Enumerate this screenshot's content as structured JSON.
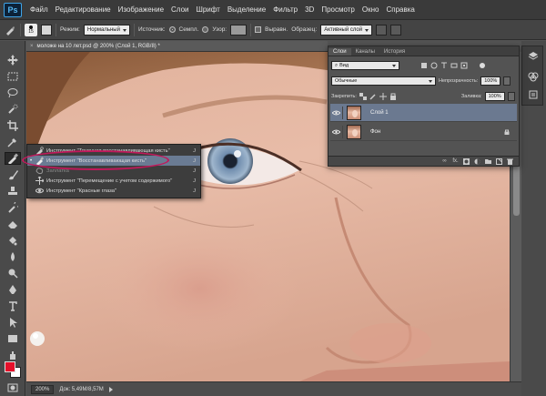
{
  "app": {
    "logo": "Ps"
  },
  "menu": {
    "items": [
      "Файл",
      "Редактирование",
      "Изображение",
      "Слои",
      "Шрифт",
      "Выделение",
      "Фильтр",
      "3D",
      "Просмотр",
      "Окно",
      "Справка"
    ]
  },
  "options": {
    "brush_size": "15",
    "mode_label": "Режим:",
    "mode_value": "Нормальный",
    "source_label": "Источник:",
    "source_sampled": "Семпл.",
    "source_pattern": "Узор:",
    "aligned_label": "Выравн.",
    "sample_label": "Образец:",
    "sample_value": "Активный слой"
  },
  "document": {
    "tab_title": "моложе на 10 лет.psd @ 200% (Слой 1, RGB/8) *",
    "status_zoom": "200%",
    "status_doc": "Док: 5,49M/8,57M"
  },
  "tool_flyout": {
    "items": [
      {
        "label": "Инструмент \"Точечная восстанавливающая кисть\"",
        "key": "J",
        "selected": false,
        "checked": false,
        "dim": false,
        "icon": "spot-healing-brush-icon"
      },
      {
        "label": "Инструмент \"Восстанавливающая кисть\"",
        "key": "J",
        "selected": true,
        "checked": true,
        "dim": false,
        "icon": "healing-brush-icon"
      },
      {
        "label": "Заплатка",
        "key": "J",
        "selected": false,
        "checked": false,
        "dim": true,
        "icon": "patch-icon"
      },
      {
        "label": "Инструмент \"Перемещение с учетом содержимого\"",
        "key": "J",
        "selected": false,
        "checked": false,
        "dim": false,
        "icon": "content-aware-move-icon"
      },
      {
        "label": "Инструмент \"Красные глаза\"",
        "key": "J",
        "selected": false,
        "checked": false,
        "dim": false,
        "icon": "red-eye-icon"
      }
    ]
  },
  "layers_panel": {
    "tabs": [
      "Слои",
      "Каналы",
      "История"
    ],
    "active_tab": "Слои",
    "filter_value": "Вид",
    "blend_mode": "Обычные",
    "opacity_label": "Непрозрачность:",
    "opacity_value": "100%",
    "lock_label": "Закрепить:",
    "fill_label": "Заливка:",
    "fill_value": "100%",
    "layers": [
      {
        "name": "Слой 1",
        "selected": true,
        "locked": false
      },
      {
        "name": "Фон",
        "selected": false,
        "locked": true
      }
    ],
    "footer_icons": [
      "link-icon",
      "fx-icon",
      "mask-icon",
      "adjustment-icon",
      "folder-icon",
      "new-layer-icon",
      "trash-icon"
    ],
    "footer_fx": "fx."
  },
  "colors": {
    "foreground": "#e5102a",
    "background": "#ffffff",
    "selection": "#6a7b93",
    "annotation_ring": "#c2185b"
  }
}
